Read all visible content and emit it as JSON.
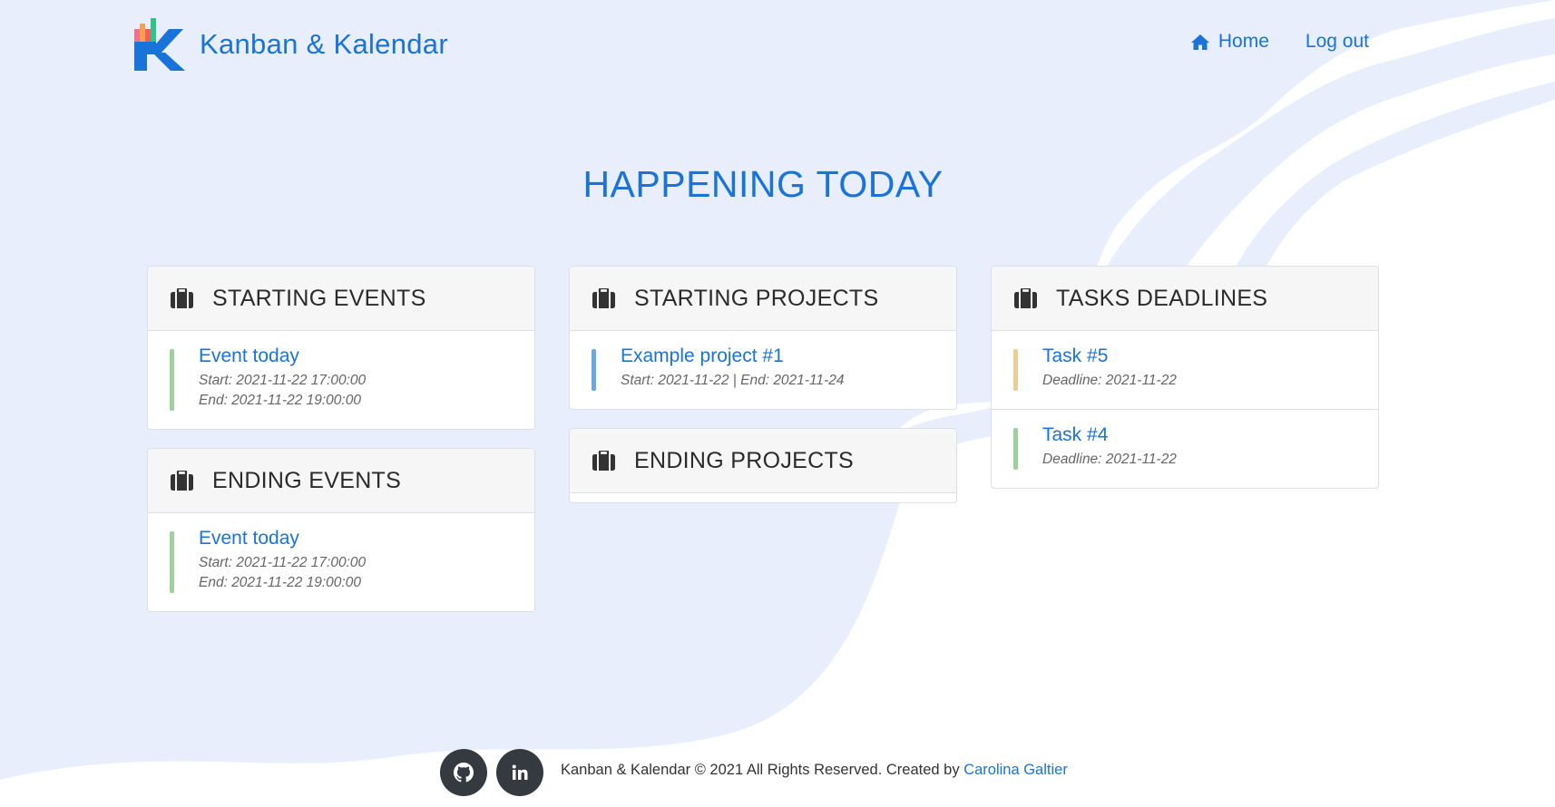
{
  "brand": {
    "name": "Kanban & Kalendar",
    "icon": "kanban-kalendar-logo"
  },
  "nav": {
    "home_label": "Home",
    "logout_label": "Log out",
    "home_icon": "home-icon"
  },
  "page_title": "HAPPENING TODAY",
  "sections": {
    "starting_events": {
      "title": "STARTING EVENTS",
      "items": [
        {
          "title": "Event today",
          "meta1": "Start: 2021-11-22 17:00:00",
          "meta2": "End: 2021-11-22 19:00:00",
          "color": "#99d39b"
        }
      ]
    },
    "ending_events": {
      "title": "ENDING EVENTS",
      "items": [
        {
          "title": "Event today",
          "meta1": "Start: 2021-11-22 17:00:00",
          "meta2": "End: 2021-11-22 19:00:00",
          "color": "#99d39b"
        }
      ]
    },
    "starting_projects": {
      "title": "STARTING PROJECTS",
      "items": [
        {
          "title": "Example project #1",
          "meta1": "Start: 2021-11-22 | End: 2021-11-24",
          "color": "#6aa9e0"
        }
      ]
    },
    "ending_projects": {
      "title": "ENDING PROJECTS",
      "items": []
    },
    "tasks_deadlines": {
      "title": "TASKS DEADLINES",
      "items": [
        {
          "title": "Task #5",
          "meta1": "Deadline: 2021-11-22",
          "color": "#f1cd94"
        },
        {
          "title": "Task #4",
          "meta1": "Deadline: 2021-11-22",
          "color": "#99d39b"
        }
      ]
    }
  },
  "footer": {
    "text": "Kanban & Kalendar © 2021 All Rights Reserved. Created by",
    "author": "Carolina Galtier",
    "socials": [
      "github-icon",
      "linkedin-icon"
    ]
  },
  "colors": {
    "accent": "#1a73d9",
    "background": "#e8eefc",
    "dark": "#343a40"
  }
}
